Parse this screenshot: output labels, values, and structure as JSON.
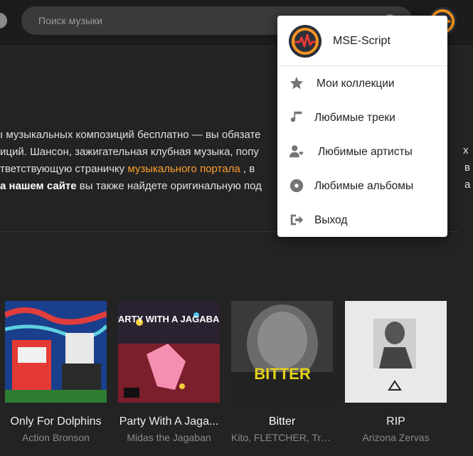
{
  "search": {
    "placeholder": "Поиск музыки"
  },
  "intro": {
    "line1": "ı музыкальных композиций бесплатно — вы обязате",
    "line2": "иций. Шансон, зажигательная клубная музыка, попу",
    "line3_pre": "тветствующую страничку ",
    "line3_link": "музыкального портала",
    "line3_post": " , в",
    "line4_bold": "а нашем сайте",
    "line4_post": " вы также найдете оригинальную под",
    "tail2": "х",
    "tail3": "в",
    "tail4": "а"
  },
  "albums": [
    {
      "title": "Only For Dolphins",
      "artist": "Action Bronson"
    },
    {
      "title": "Party With A Jaga...",
      "artist": "Midas the Jagaban",
      "cover_text": "PARTY WITH A JAGABAN"
    },
    {
      "title": "Bitter",
      "artist": "Kito, FLETCHER, Trev...",
      "cover_text": "BITTER"
    },
    {
      "title": "RIP",
      "artist": "Arizona Zervas"
    }
  ],
  "menu": {
    "username": "MSE-Script",
    "items": [
      {
        "label": "Мои коллекции",
        "icon": "star-icon"
      },
      {
        "label": "Любимые треки",
        "icon": "music-note-icon"
      },
      {
        "label": "Любимые артисты",
        "icon": "user-heart-icon"
      },
      {
        "label": "Любимые альбомы",
        "icon": "disc-icon"
      },
      {
        "label": "Выход",
        "icon": "logout-icon"
      }
    ]
  },
  "colors": {
    "accent": "#ff9f2f",
    "background": "#232323",
    "menu_bg": "#ffffff"
  }
}
